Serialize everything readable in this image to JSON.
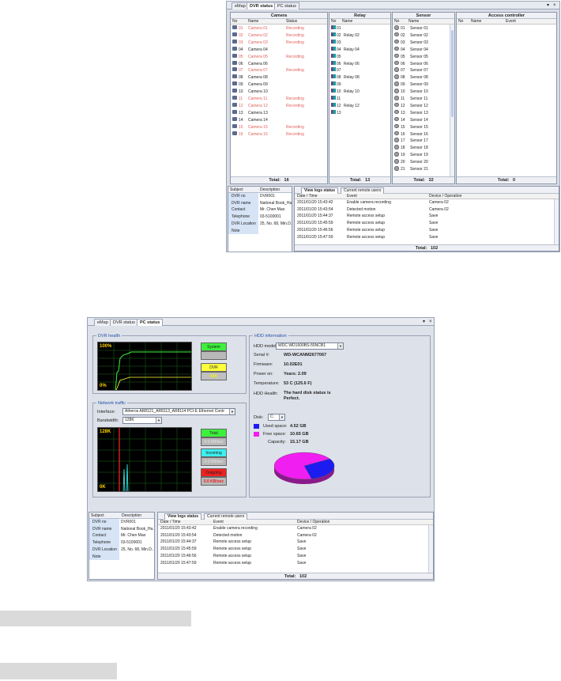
{
  "tabs": {
    "emap": "eMap",
    "dvr": "DVR status",
    "pc": "PC status"
  },
  "window_buttons": {
    "pin": "▾",
    "close": "×"
  },
  "camera": {
    "title": "Camera",
    "headers": {
      "no": "No",
      "name": "Name",
      "status": "Status"
    },
    "rows": [
      {
        "no": "01",
        "name": "Camera 01",
        "status": "Recording",
        "rec": true
      },
      {
        "no": "02",
        "name": "Camera 02",
        "status": "Recording",
        "rec": true
      },
      {
        "no": "03",
        "name": "Camera 03",
        "status": "Recording",
        "rec": true
      },
      {
        "no": "04",
        "name": "Camera 04",
        "status": "",
        "rec": false
      },
      {
        "no": "05",
        "name": "Camera 05",
        "status": "Recording",
        "rec": true
      },
      {
        "no": "06",
        "name": "Camera 06",
        "status": "",
        "rec": false
      },
      {
        "no": "07",
        "name": "Camera 07",
        "status": "Recording",
        "rec": true
      },
      {
        "no": "08",
        "name": "Camera 08",
        "status": "",
        "rec": false
      },
      {
        "no": "09",
        "name": "Camera 09",
        "status": "",
        "rec": false
      },
      {
        "no": "10",
        "name": "Camera 10",
        "status": "",
        "rec": false
      },
      {
        "no": "11",
        "name": "Camera 11",
        "status": "Recording",
        "rec": true
      },
      {
        "no": "12",
        "name": "Camera 12",
        "status": "Recording",
        "rec": true
      },
      {
        "no": "13",
        "name": "Camera 13",
        "status": "",
        "rec": false
      },
      {
        "no": "14",
        "name": "Camera 14",
        "status": "",
        "rec": false
      },
      {
        "no": "15",
        "name": "Camera 15",
        "status": "Recording",
        "rec": true
      },
      {
        "no": "16",
        "name": "Camera 16",
        "status": "Recording",
        "rec": true
      }
    ],
    "total_label": "Total:",
    "total": "16"
  },
  "relay": {
    "title": "Relay",
    "headers": {
      "no": "No",
      "name": "Name"
    },
    "rows": [
      {
        "no": "01",
        "name": ""
      },
      {
        "no": "02",
        "name": "Relay 02"
      },
      {
        "no": "03",
        "name": ""
      },
      {
        "no": "04",
        "name": "Relay 04"
      },
      {
        "no": "05",
        "name": ""
      },
      {
        "no": "06",
        "name": "Relay 06"
      },
      {
        "no": "07",
        "name": ""
      },
      {
        "no": "08",
        "name": "Relay 08"
      },
      {
        "no": "09",
        "name": ""
      },
      {
        "no": "10",
        "name": "Relay 10"
      },
      {
        "no": "11",
        "name": ""
      },
      {
        "no": "12",
        "name": "Relay 12"
      },
      {
        "no": "13",
        "name": ""
      }
    ],
    "total_label": "Total:",
    "total": "13"
  },
  "sensor": {
    "title": "Sensor",
    "headers": {
      "no": "No",
      "name": "Name"
    },
    "rows": [
      {
        "no": "01",
        "name": "Sensor 01"
      },
      {
        "no": "02",
        "name": "Sensor 02"
      },
      {
        "no": "03",
        "name": "Sensor 03"
      },
      {
        "no": "04",
        "name": "Sensor 04"
      },
      {
        "no": "05",
        "name": "Sensor 05"
      },
      {
        "no": "06",
        "name": "Sensor 06"
      },
      {
        "no": "07",
        "name": "Sensor 07"
      },
      {
        "no": "08",
        "name": "Sensor 08"
      },
      {
        "no": "09",
        "name": "Sensor 09"
      },
      {
        "no": "10",
        "name": "Sensor 10"
      },
      {
        "no": "11",
        "name": "Sensor 11"
      },
      {
        "no": "12",
        "name": "Sensor 12"
      },
      {
        "no": "13",
        "name": "Sensor 13"
      },
      {
        "no": "14",
        "name": "Sensor 14"
      },
      {
        "no": "15",
        "name": "Sensor 15"
      },
      {
        "no": "16",
        "name": "Sensor 16"
      },
      {
        "no": "17",
        "name": "Sensor 17"
      },
      {
        "no": "18",
        "name": "Sensor 18"
      },
      {
        "no": "19",
        "name": "Sensor 19"
      },
      {
        "no": "20",
        "name": "Sensor 20"
      },
      {
        "no": "21",
        "name": "Sensor 21"
      }
    ],
    "total_label": "Total:",
    "total": "32"
  },
  "access": {
    "title": "Access controller",
    "headers": {
      "no": "No",
      "name": "Name",
      "event": "Event"
    },
    "total_label": "Total:",
    "total": "0"
  },
  "info": {
    "headers": {
      "subject": "Subject",
      "description": "Description"
    },
    "rows": [
      {
        "subject": "DVR no",
        "description": "DVR001"
      },
      {
        "subject": "DVR name",
        "description": "National Book_Ha.."
      },
      {
        "subject": "Contact",
        "description": "Mr. Chen Mao"
      },
      {
        "subject": "Telephone",
        "description": "03-5100001"
      },
      {
        "subject": "DVR Location",
        "description": "25, No. 68, Min.D.."
      },
      {
        "subject": "Note",
        "description": ""
      }
    ]
  },
  "logs": {
    "tab_view": "View logs status",
    "tab_users": "Current remote users",
    "headers": {
      "date": "Date / Time",
      "event": "Event",
      "device": "Device / Operation"
    },
    "rows": [
      {
        "date": "2011/01/20 15:43:42",
        "event": "Enable camera recording",
        "device": "Camera 02"
      },
      {
        "date": "2011/01/20 15:43:54",
        "event": "Detected motion",
        "device": "Camera 02"
      },
      {
        "date": "2011/01/20 15:44:37",
        "event": "Remote access setup",
        "device": "Save"
      },
      {
        "date": "2011/01/20 15:45:59",
        "event": "Remote access setup",
        "device": "Save"
      },
      {
        "date": "2011/01/20 15:46:56",
        "event": "Remote access setup",
        "device": "Save"
      },
      {
        "date": "2011/01/20 15:47:59",
        "event": "Remote access setup",
        "device": "Save"
      }
    ],
    "total_label": "Total:",
    "total": "102"
  },
  "pc": {
    "dvr_health": {
      "caption": "DVR health",
      "top": "100%",
      "bottom": "0%",
      "system_label": "System",
      "system_value": "",
      "dvr_label": "DVR",
      "dvr_value": "41K"
    },
    "network": {
      "caption": "Network traffic",
      "interface_label": "Interface:",
      "interface_value": "Atheros AR8121_AR8113_AR8114 PCI-E Ethernet Contr",
      "bandwidth_label": "Bandwidth:",
      "bandwidth_value": "128K",
      "top": "128K",
      "bottom": "0K",
      "total_label": "Total",
      "total_value": "0.0 KB/sec",
      "incoming_label": "Incoming",
      "incoming_value": "0.0 KB/sec",
      "outgoing_label": "Outgoing",
      "outgoing_value": "0.0 KB/sec"
    },
    "hdd": {
      "caption": "HDD information",
      "model_label": "HDD model:",
      "model_value": "WDC WD1600BS-55NCB1",
      "serial_label": "Serial #:",
      "serial_value": "WD-WCANM2677067",
      "firmware_label": "Firmware:",
      "firmware_value": "10.02E01",
      "poweron_label": "Power on:",
      "poweron_value": "Years: 2.09",
      "temp_label": "Temperature:",
      "temp_value": "53 C (125.6 F)",
      "health_label": "HDD Health:",
      "health_value": "The hard disk status is Perfect.",
      "disk_label": "Disk:",
      "disk_value": "C:",
      "used_label": "Used space:",
      "used_value": "4.52 GB",
      "free_label": "Free space:",
      "free_value": "10.65 GB",
      "capacity_label": "Capacity:",
      "capacity_value": "15.17 GB",
      "used_gb": 4.52,
      "free_gb": 10.65,
      "used_color": "#1c1cf0",
      "free_color": "#f01ef0"
    }
  },
  "colors": {
    "system": "#3cf03c",
    "dvr": "#ffff3c",
    "total": "#3cf03c",
    "incoming": "#3cf0f0",
    "outgoing": "#f02020",
    "graph_line": "#3cf03c"
  }
}
